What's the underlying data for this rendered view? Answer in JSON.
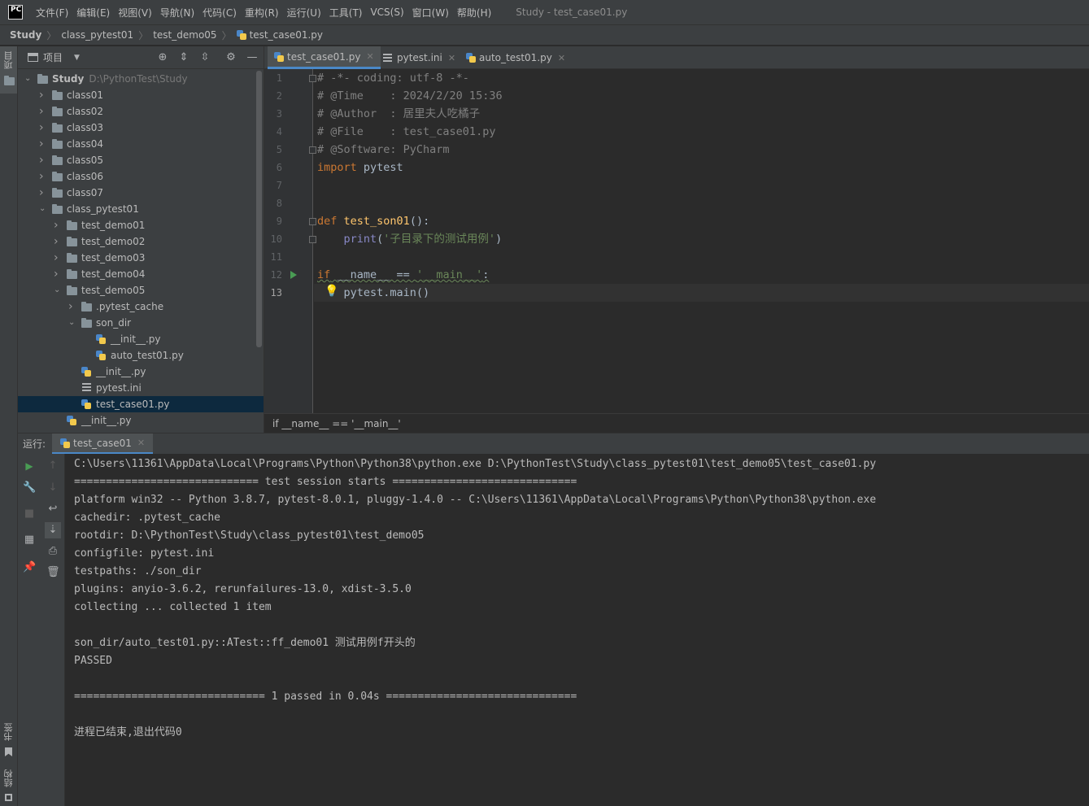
{
  "app": {
    "logo": "PC",
    "window_title": "Study - test_case01.py",
    "menus": [
      "文件(F)",
      "编辑(E)",
      "视图(V)",
      "导航(N)",
      "代码(C)",
      "重构(R)",
      "运行(U)",
      "工具(T)",
      "VCS(S)",
      "窗口(W)",
      "帮助(H)"
    ]
  },
  "breadcrumb": [
    "Study",
    "class_pytest01",
    "test_demo05",
    "test_case01.py"
  ],
  "side_stripe": {
    "project": "项目",
    "bookmarks": "书签",
    "structure": "结构"
  },
  "project_panel": {
    "title": "项目",
    "tree": [
      {
        "label": "Study",
        "path": "D:\\PythonTest\\Study",
        "type": "folder",
        "indent": 0,
        "open": true
      },
      {
        "label": "class01",
        "type": "folder",
        "indent": 1,
        "open": false
      },
      {
        "label": "class02",
        "type": "folder",
        "indent": 1,
        "open": false
      },
      {
        "label": "class03",
        "type": "folder",
        "indent": 1,
        "open": false
      },
      {
        "label": "class04",
        "type": "folder",
        "indent": 1,
        "open": false
      },
      {
        "label": "class05",
        "type": "folder",
        "indent": 1,
        "open": false
      },
      {
        "label": "class06",
        "type": "folder",
        "indent": 1,
        "open": false
      },
      {
        "label": "class07",
        "type": "folder",
        "indent": 1,
        "open": false
      },
      {
        "label": "class_pytest01",
        "type": "folder",
        "indent": 1,
        "open": true
      },
      {
        "label": "test_demo01",
        "type": "folder",
        "indent": 2,
        "open": false
      },
      {
        "label": "test_demo02",
        "type": "folder",
        "indent": 2,
        "open": false
      },
      {
        "label": "test_demo03",
        "type": "folder",
        "indent": 2,
        "open": false
      },
      {
        "label": "test_demo04",
        "type": "folder",
        "indent": 2,
        "open": false
      },
      {
        "label": "test_demo05",
        "type": "folder",
        "indent": 2,
        "open": true
      },
      {
        "label": ".pytest_cache",
        "type": "folder",
        "indent": 3,
        "open": false
      },
      {
        "label": "son_dir",
        "type": "folder",
        "indent": 3,
        "open": true
      },
      {
        "label": "__init__.py",
        "type": "py",
        "indent": 4
      },
      {
        "label": "auto_test01.py",
        "type": "py",
        "indent": 4
      },
      {
        "label": "__init__.py",
        "type": "py",
        "indent": 3
      },
      {
        "label": "pytest.ini",
        "type": "ini",
        "indent": 3
      },
      {
        "label": "test_case01.py",
        "type": "py",
        "indent": 3,
        "selected": true
      },
      {
        "label": "__init__.py",
        "type": "py",
        "indent": 2
      }
    ]
  },
  "editor_tabs": [
    {
      "label": "test_case01.py",
      "type": "py",
      "active": true
    },
    {
      "label": "pytest.ini",
      "type": "ini",
      "active": false
    },
    {
      "label": "auto_test01.py",
      "type": "py",
      "active": false
    }
  ],
  "editor": {
    "line_numbers": [
      "1",
      "2",
      "3",
      "4",
      "5",
      "6",
      "7",
      "8",
      "9",
      "10",
      "11",
      "12",
      "13"
    ],
    "current_line": 13,
    "code": {
      "l1": "# -*- coding: utf-8 -*-",
      "l2": "# @Time    : 2024/2/20 15:36",
      "l3": "# @Author  : 居里夫人吃橘子",
      "l4": "# @File    : test_case01.py",
      "l5": "# @Software: PyCharm",
      "l6_kw": "import",
      "l6_rest": " pytest",
      "l9_kw": "def",
      "l9_fn": "test_son01",
      "l9_rest": "():",
      "l10_indent": "    ",
      "l10_builtin": "print",
      "l10_open": "(",
      "l10_str": "'子目录下的测试用例'",
      "l10_close": ")",
      "l12_kw": "if",
      "l12_mid": " __name__ == ",
      "l12_str": "'__main__'",
      "l12_end": ":",
      "l13": "    pytest.main()"
    },
    "breadcrumb": "if __name__ == '__main__'"
  },
  "run_panel": {
    "label": "运行:",
    "tab": "test_case01",
    "console": [
      "C:\\Users\\11361\\AppData\\Local\\Programs\\Python\\Python38\\python.exe D:\\PythonTest\\Study\\class_pytest01\\test_demo05\\test_case01.py",
      "============================= test session starts =============================",
      "platform win32 -- Python 3.8.7, pytest-8.0.1, pluggy-1.4.0 -- C:\\Users\\11361\\AppData\\Local\\Programs\\Python\\Python38\\python.exe",
      "cachedir: .pytest_cache",
      "rootdir: D:\\PythonTest\\Study\\class_pytest01\\test_demo05",
      "configfile: pytest.ini",
      "testpaths: ./son_dir",
      "plugins: anyio-3.6.2, rerunfailures-13.0, xdist-3.5.0",
      "collecting ... collected 1 item",
      "",
      "son_dir/auto_test01.py::ATest::ff_demo01 测试用例f开头的",
      "PASSED",
      "",
      "============================== 1 passed in 0.04s ==============================",
      "",
      "进程已结束,退出代码0"
    ]
  },
  "colors": {
    "accent": "#4a88c7",
    "selection": "#0d293e",
    "keyword": "#cc7832",
    "function": "#ffc66d",
    "string": "#6a8759",
    "comment": "#808080",
    "run_green": "#499c54"
  }
}
